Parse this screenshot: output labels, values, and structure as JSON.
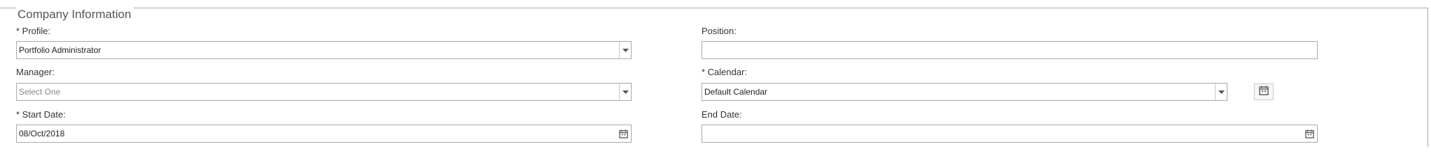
{
  "section": {
    "legend": "Company Information"
  },
  "fields": {
    "profile": {
      "label": "* Profile:",
      "value": "Portfolio Administrator"
    },
    "position": {
      "label": "Position:",
      "value": ""
    },
    "manager": {
      "label": "Manager:",
      "placeholder": "Select One",
      "value": ""
    },
    "calendar": {
      "label": "* Calendar:",
      "value": "Default Calendar"
    },
    "start_date": {
      "label": "* Start Date:",
      "value": "08/Oct/2018"
    },
    "end_date": {
      "label": "End Date:",
      "value": ""
    }
  },
  "icons": {
    "dropdown": "chevron-down-icon",
    "calendar": "calendar-icon",
    "calendar_button": "calendar-icon"
  },
  "colors": {
    "border": "#a9a9a9",
    "text": "#333333",
    "placeholder": "#888888"
  }
}
